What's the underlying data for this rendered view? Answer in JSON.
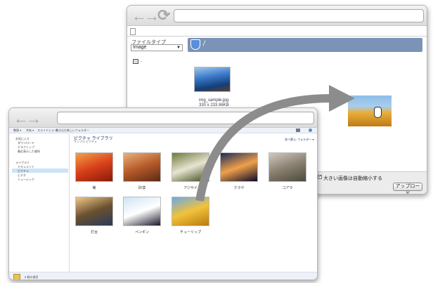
{
  "back_window": {
    "nav_back_glyph": "←",
    "nav_forward_glyph": "→",
    "reload_glyph": "⟳",
    "file_type_label": "ファイルタイプ",
    "file_type_value": "Image",
    "path_text": "/",
    "parent_folder_text": "..",
    "file_name": "img_sample.jpg",
    "file_info": "330 x 233 86KB",
    "file_extra": "86KB",
    "shrink_checkbox_label": "大きい画像は自動縮小する",
    "upload_button": "アップロード"
  },
  "front_window": {
    "nav_back_glyph": "←",
    "nav_forward_glyph": "→",
    "toolbar_items": [
      "整理 ▾",
      "共有 ▾",
      "スライドショー",
      "書き込む",
      "新しいフォルダー"
    ],
    "sidebar_favorites": [
      "お気に入り",
      "ダウンロード",
      "デスクトップ",
      "最近表示した場所"
    ],
    "sidebar_libraries": [
      "ライブラリ",
      "ドキュメント",
      "ピクチャ",
      "ビデオ",
      "ミュージック"
    ],
    "library_title": "ピクチャ ライブラリ",
    "library_subtitle": "サンプル ピクチャ",
    "arrange_label": "並べ替え: フォルダー ▾",
    "thumbnails": [
      {
        "caption": "菊",
        "colors": [
          "#f2a14a",
          "#d8401a",
          "#8a1a08"
        ]
      },
      {
        "caption": "砂漠",
        "colors": [
          "#e9b27a",
          "#b65a2a",
          "#5b2a14"
        ]
      },
      {
        "caption": "アジサイ",
        "colors": [
          "#6b7a3a",
          "#e8e4d2",
          "#3a4a1a"
        ]
      },
      {
        "caption": "クラゲ",
        "colors": [
          "#1a2a5a",
          "#f0a04a",
          "#0a0a2a"
        ]
      },
      {
        "caption": "コアラ",
        "colors": [
          "#cfcac0",
          "#8a8070",
          "#4a4a3a"
        ]
      },
      {
        "caption": "灯台",
        "colors": [
          "#f0c88a",
          "#6a5030",
          "#2a3a5a"
        ]
      },
      {
        "caption": "ペンギン",
        "colors": [
          "#cde4f4",
          "#ffffff",
          "#1a1a2a"
        ]
      },
      {
        "caption": "チューリップ",
        "colors": [
          "#6aa8e8",
          "#f2c23a",
          "#b87a10"
        ]
      }
    ],
    "status_text": "8 個の項目"
  },
  "colors": {
    "path_bar": "#7a93b6",
    "arrow": "#8c8c8c",
    "title_bar": "#e6e6e6"
  }
}
